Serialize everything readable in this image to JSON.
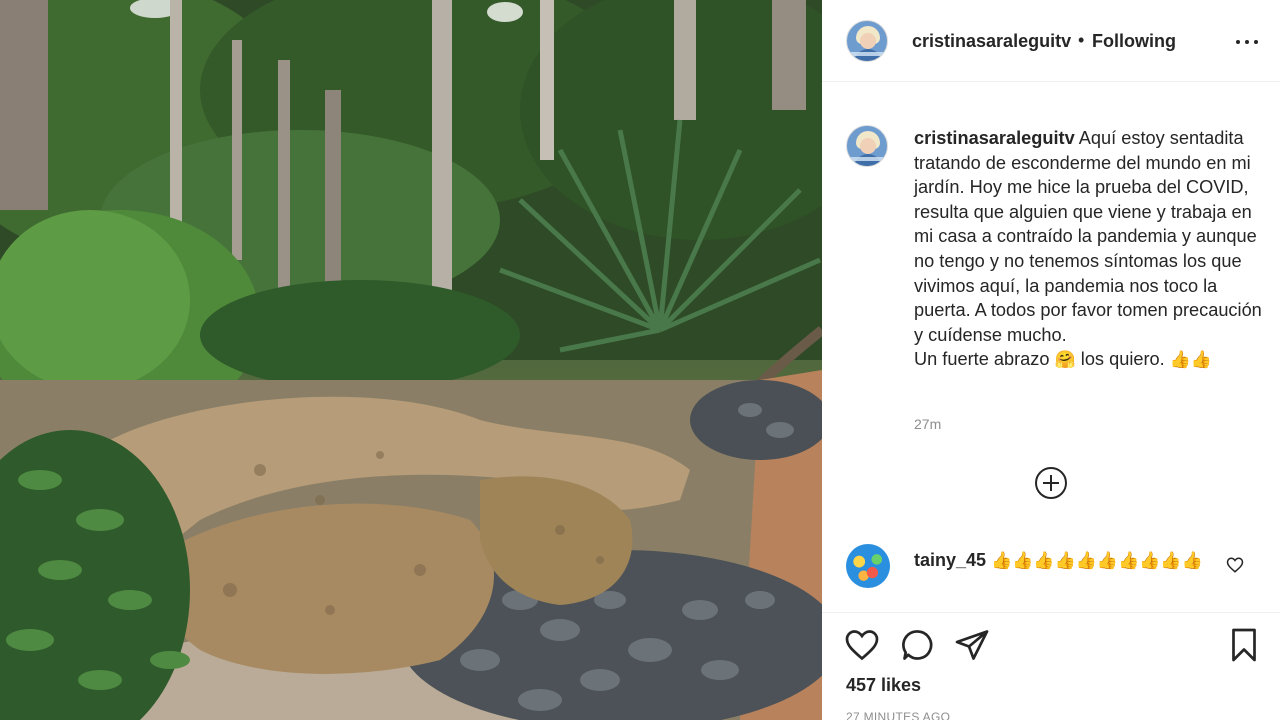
{
  "photo": {
    "alt_icon": "garden-photo"
  },
  "header": {
    "username": "cristinasaraleguitv",
    "separator": "•",
    "follow_label": "Following",
    "more_icon": "more-options-icon"
  },
  "caption": {
    "username": "cristinasaraleguitv",
    "text": "Aquí estoy sentadita tratando de esconderme del mundo en mi jardín. Hoy me hice la prueba del COVID, resulta que alguien que viene y trabaja en mi casa a contraído la pandemia y aunque no tengo y no tenemos síntomas los que vivimos aquí, la pandemia nos toco la puerta. A todos por favor tomen precaución y cuídense mucho.",
    "text_line2_pre": "Un fuerte abrazo",
    "text_line2_emoji": "🤗",
    "text_line2_mid": "los quiero.",
    "text_line2_end": "👍👍",
    "time": "27m"
  },
  "load_more_icon": "plus-circle-icon",
  "comment": {
    "username": "tainy_45",
    "text": "👍👍👍👍👍👍👍👍👍👍"
  },
  "actions": {
    "likes": "457 likes",
    "ago": "27 MINUTES AGO"
  }
}
